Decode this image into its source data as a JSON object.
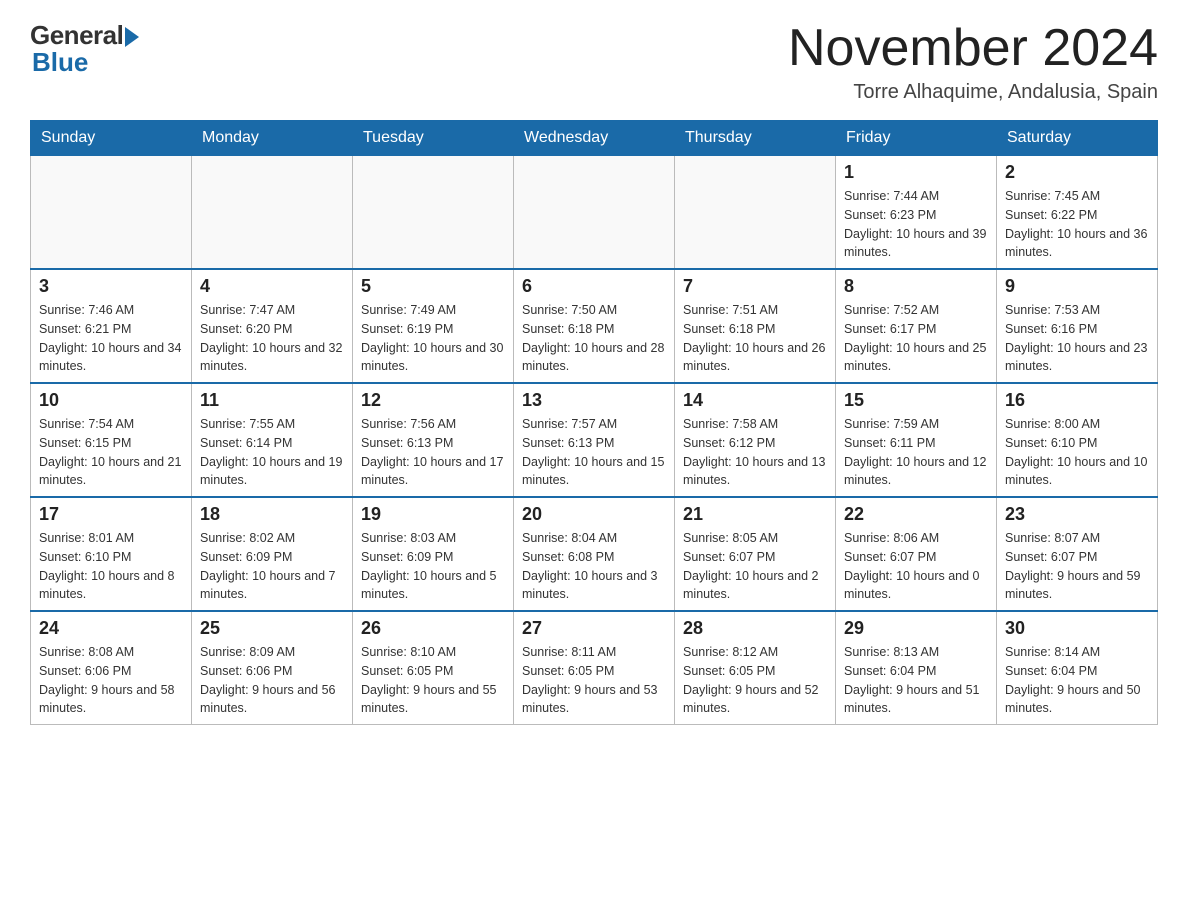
{
  "logo": {
    "general": "General",
    "blue": "Blue"
  },
  "title": "November 2024",
  "subtitle": "Torre Alhaquime, Andalusia, Spain",
  "weekdays": [
    "Sunday",
    "Monday",
    "Tuesday",
    "Wednesday",
    "Thursday",
    "Friday",
    "Saturday"
  ],
  "weeks": [
    [
      {
        "day": "",
        "info": ""
      },
      {
        "day": "",
        "info": ""
      },
      {
        "day": "",
        "info": ""
      },
      {
        "day": "",
        "info": ""
      },
      {
        "day": "",
        "info": ""
      },
      {
        "day": "1",
        "info": "Sunrise: 7:44 AM\nSunset: 6:23 PM\nDaylight: 10 hours and 39 minutes."
      },
      {
        "day": "2",
        "info": "Sunrise: 7:45 AM\nSunset: 6:22 PM\nDaylight: 10 hours and 36 minutes."
      }
    ],
    [
      {
        "day": "3",
        "info": "Sunrise: 7:46 AM\nSunset: 6:21 PM\nDaylight: 10 hours and 34 minutes."
      },
      {
        "day": "4",
        "info": "Sunrise: 7:47 AM\nSunset: 6:20 PM\nDaylight: 10 hours and 32 minutes."
      },
      {
        "day": "5",
        "info": "Sunrise: 7:49 AM\nSunset: 6:19 PM\nDaylight: 10 hours and 30 minutes."
      },
      {
        "day": "6",
        "info": "Sunrise: 7:50 AM\nSunset: 6:18 PM\nDaylight: 10 hours and 28 minutes."
      },
      {
        "day": "7",
        "info": "Sunrise: 7:51 AM\nSunset: 6:18 PM\nDaylight: 10 hours and 26 minutes."
      },
      {
        "day": "8",
        "info": "Sunrise: 7:52 AM\nSunset: 6:17 PM\nDaylight: 10 hours and 25 minutes."
      },
      {
        "day": "9",
        "info": "Sunrise: 7:53 AM\nSunset: 6:16 PM\nDaylight: 10 hours and 23 minutes."
      }
    ],
    [
      {
        "day": "10",
        "info": "Sunrise: 7:54 AM\nSunset: 6:15 PM\nDaylight: 10 hours and 21 minutes."
      },
      {
        "day": "11",
        "info": "Sunrise: 7:55 AM\nSunset: 6:14 PM\nDaylight: 10 hours and 19 minutes."
      },
      {
        "day": "12",
        "info": "Sunrise: 7:56 AM\nSunset: 6:13 PM\nDaylight: 10 hours and 17 minutes."
      },
      {
        "day": "13",
        "info": "Sunrise: 7:57 AM\nSunset: 6:13 PM\nDaylight: 10 hours and 15 minutes."
      },
      {
        "day": "14",
        "info": "Sunrise: 7:58 AM\nSunset: 6:12 PM\nDaylight: 10 hours and 13 minutes."
      },
      {
        "day": "15",
        "info": "Sunrise: 7:59 AM\nSunset: 6:11 PM\nDaylight: 10 hours and 12 minutes."
      },
      {
        "day": "16",
        "info": "Sunrise: 8:00 AM\nSunset: 6:10 PM\nDaylight: 10 hours and 10 minutes."
      }
    ],
    [
      {
        "day": "17",
        "info": "Sunrise: 8:01 AM\nSunset: 6:10 PM\nDaylight: 10 hours and 8 minutes."
      },
      {
        "day": "18",
        "info": "Sunrise: 8:02 AM\nSunset: 6:09 PM\nDaylight: 10 hours and 7 minutes."
      },
      {
        "day": "19",
        "info": "Sunrise: 8:03 AM\nSunset: 6:09 PM\nDaylight: 10 hours and 5 minutes."
      },
      {
        "day": "20",
        "info": "Sunrise: 8:04 AM\nSunset: 6:08 PM\nDaylight: 10 hours and 3 minutes."
      },
      {
        "day": "21",
        "info": "Sunrise: 8:05 AM\nSunset: 6:07 PM\nDaylight: 10 hours and 2 minutes."
      },
      {
        "day": "22",
        "info": "Sunrise: 8:06 AM\nSunset: 6:07 PM\nDaylight: 10 hours and 0 minutes."
      },
      {
        "day": "23",
        "info": "Sunrise: 8:07 AM\nSunset: 6:07 PM\nDaylight: 9 hours and 59 minutes."
      }
    ],
    [
      {
        "day": "24",
        "info": "Sunrise: 8:08 AM\nSunset: 6:06 PM\nDaylight: 9 hours and 58 minutes."
      },
      {
        "day": "25",
        "info": "Sunrise: 8:09 AM\nSunset: 6:06 PM\nDaylight: 9 hours and 56 minutes."
      },
      {
        "day": "26",
        "info": "Sunrise: 8:10 AM\nSunset: 6:05 PM\nDaylight: 9 hours and 55 minutes."
      },
      {
        "day": "27",
        "info": "Sunrise: 8:11 AM\nSunset: 6:05 PM\nDaylight: 9 hours and 53 minutes."
      },
      {
        "day": "28",
        "info": "Sunrise: 8:12 AM\nSunset: 6:05 PM\nDaylight: 9 hours and 52 minutes."
      },
      {
        "day": "29",
        "info": "Sunrise: 8:13 AM\nSunset: 6:04 PM\nDaylight: 9 hours and 51 minutes."
      },
      {
        "day": "30",
        "info": "Sunrise: 8:14 AM\nSunset: 6:04 PM\nDaylight: 9 hours and 50 minutes."
      }
    ]
  ]
}
